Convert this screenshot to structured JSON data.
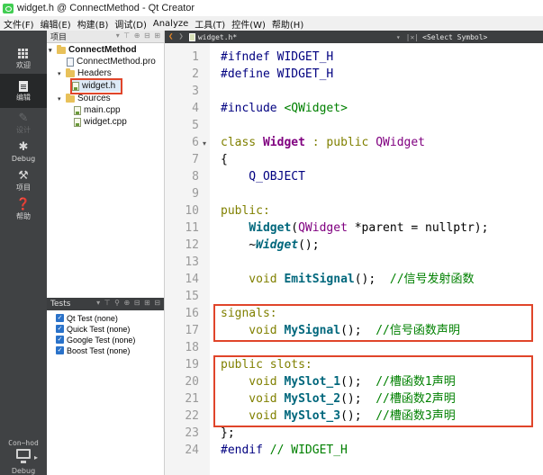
{
  "window": {
    "title": "widget.h @ ConnectMethod - Qt Creator"
  },
  "menu": [
    "文件(F)",
    "编辑(E)",
    "构建(B)",
    "调试(D)",
    "Analyze",
    "工具(T)",
    "控件(W)",
    "帮助(H)"
  ],
  "modes": [
    {
      "label": "欢迎",
      "icon": "welcome-grid-icon"
    },
    {
      "label": "编辑",
      "icon": "edit-document-icon"
    },
    {
      "label": "设计",
      "icon": "design-pen-icon"
    },
    {
      "label": "Debug",
      "icon": "debug-bug-icon"
    },
    {
      "label": "项目",
      "icon": "projects-wrench-icon"
    },
    {
      "label": "帮助",
      "icon": "help-question-icon"
    }
  ],
  "mode_footer": {
    "project": "Con~hod",
    "debug": "Debug"
  },
  "project_pane": {
    "view_selector": "项目",
    "tree": {
      "project": "ConnectMethod",
      "pro_file": "ConnectMethod.pro",
      "headers": "Headers",
      "header_file": "widget.h",
      "sources": "Sources",
      "source_files": [
        "main.cpp",
        "widget.cpp"
      ]
    }
  },
  "tests_pane": {
    "title": "Tests",
    "items": [
      "Qt Test (none)",
      "Quick Test (none)",
      "Google Test (none)",
      "Boost Test (none)"
    ]
  },
  "editor": {
    "tab": "widget.h*",
    "symbol_placeholder": "<Select Symbol>",
    "line_numbers": [
      "1",
      "2",
      "3",
      "4",
      "5",
      "6",
      "7",
      "8",
      "9",
      "10",
      "11",
      "12",
      "13",
      "14",
      "15",
      "16",
      "17",
      "18",
      "19",
      "20",
      "21",
      "22",
      "23",
      "24"
    ],
    "code": {
      "l1": {
        "directive": "#ifndef",
        "rest": " WIDGET_H"
      },
      "l2": {
        "directive": "#define",
        "rest": " WIDGET_H"
      },
      "l4": {
        "directive": "#include",
        "header": " <QWidget>"
      },
      "l6": {
        "kw": "class",
        "name": " Widget",
        "rest": " : public ",
        "base": "QWidget"
      },
      "l7": "{",
      "l8": "    Q_OBJECT",
      "l10": "public:",
      "l11": {
        "indent": "    ",
        "name": "Widget",
        "open": "(",
        "type": "QWidget",
        "rest": " *parent = nullptr);"
      },
      "l12": {
        "indent": "    ~",
        "name": "Widget",
        "rest": "();"
      },
      "l14": {
        "kw": "    void ",
        "name": "EmitSignal",
        "rest": "();  ",
        "comment": "//信号发射函数"
      },
      "l16": "signals:",
      "l17": {
        "kw": "    void ",
        "name": "MySignal",
        "rest": "();  ",
        "comment": "//信号函数声明"
      },
      "l19": "public slots:",
      "l20": {
        "kw": "    void ",
        "name": "MySlot_1",
        "rest": "();  ",
        "comment": "//槽函数1声明"
      },
      "l21": {
        "kw": "    void ",
        "name": "MySlot_2",
        "rest": "();  ",
        "comment": "//槽函数2声明"
      },
      "l22": {
        "kw": "    void ",
        "name": "MySlot_3",
        "rest": "();  ",
        "comment": "//槽函数3声明"
      },
      "l23": "};",
      "l24": {
        "directive": "#endif",
        "comment": " // WIDGET_H"
      }
    }
  },
  "colors": {
    "highlight": "#e0452a",
    "keyword": "#808000",
    "function": "#00677c",
    "comment": "#008000",
    "type": "#800080"
  }
}
